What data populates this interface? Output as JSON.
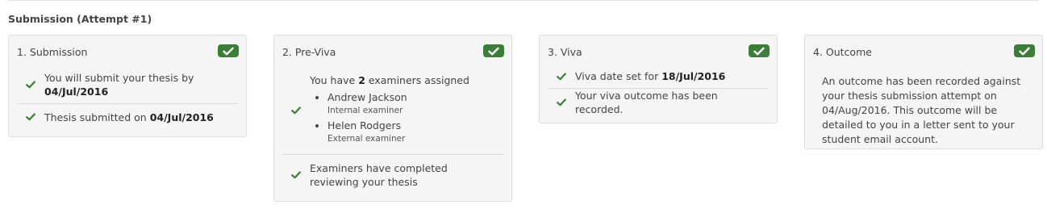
{
  "section_title": "Submission (Attempt #1)",
  "colors": {
    "accent_green": "#3c7d3a",
    "card_bg": "#f5f5f5"
  },
  "cards": [
    {
      "title": "1. Submission",
      "status_icon": "check-badge",
      "items": [
        {
          "prefix": "You will submit your thesis by",
          "value": "04/Jul/2016"
        },
        {
          "prefix": "Thesis submitted on",
          "value": "04/Jul/2016"
        }
      ]
    },
    {
      "title": "2. Pre-Viva",
      "status_icon": "check-badge",
      "examiners_intro": {
        "prefix": "You have",
        "count": "2",
        "suffix": "examiners assigned"
      },
      "examiners": [
        {
          "name": "Andrew Jackson",
          "role": "Internal examiner"
        },
        {
          "name": "Helen Rodgers",
          "role": "External examiner"
        }
      ],
      "review_status": "Examiners have completed reviewing your thesis"
    },
    {
      "title": "3. Viva",
      "status_icon": "check-badge",
      "items": [
        {
          "prefix": "Viva date set for",
          "value": "18/Jul/2016"
        },
        {
          "prefix": "Your viva outcome has been recorded.",
          "value": ""
        }
      ]
    },
    {
      "title": "4. Outcome",
      "status_icon": "check-badge",
      "text": "An outcome has been recorded against your thesis submission attempt on 04/Aug/2016. This outcome will be detailed to you in a letter sent to your student email account."
    }
  ]
}
